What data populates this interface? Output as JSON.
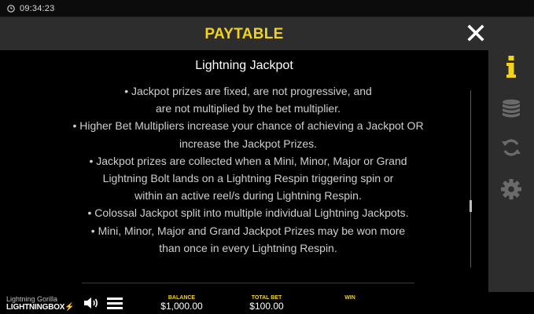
{
  "status": {
    "time": "09:34:23"
  },
  "header": {
    "title": "PAYTABLE"
  },
  "content": {
    "heading": "Lightning Jackpot",
    "lines": [
      "• Jackpot prizes are fixed, are not progressive, and",
      "are not multiplied by the bet multiplier.",
      "• Higher Bet Multipliers increase your chance of achieving a Jackpot OR",
      "increase the Jackpot Prizes.",
      "• Jackpot prizes are collected when a Mini, Minor, Major or Grand",
      "Lightning Bolt lands on a Lightning Respin triggering spin or",
      "within an active reel/s during Lightning Respin.",
      "• Colossal Jackpot split into multiple individual Lightning Jackpots.",
      "• Mini, Minor, Major and Grand Jackpot Prizes may be won more",
      "than once in every Lightning Respin."
    ]
  },
  "sidemenu": {
    "items": [
      {
        "icon": "info-icon",
        "active": true
      },
      {
        "icon": "coins-stack-icon",
        "active": false
      },
      {
        "icon": "autoplay-icon",
        "active": false
      },
      {
        "icon": "settings-gear-icon",
        "active": false
      }
    ]
  },
  "footer": {
    "game_name": "Lightning Gorilla",
    "brand": "LIGHTNINGBOX",
    "balance_label": "BALANCE",
    "balance_value": "$1,000.00",
    "total_bet_label": "TOTAL BET",
    "total_bet_value": "$100.00",
    "win_label": "WIN",
    "win_value": ""
  },
  "colors": {
    "accent": "#f2d21b",
    "panel": "#2d2d2d",
    "background": "#000000",
    "text": "#cfcfcf"
  }
}
